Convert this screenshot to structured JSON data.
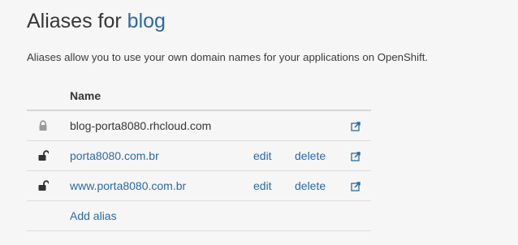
{
  "heading": {
    "prefix": "Aliases for",
    "app_name": "blog"
  },
  "description": "Aliases allow you to use your own domain names for your applications on OpenShift.",
  "table": {
    "column_name": "Name",
    "rows": [
      {
        "name": "blog-porta8080.rhcloud.com",
        "locked": true,
        "edit": "",
        "delete": ""
      },
      {
        "name": "porta8080.com.br",
        "locked": false,
        "edit": "edit",
        "delete": "delete"
      },
      {
        "name": "www.porta8080.com.br",
        "locked": false,
        "edit": "edit",
        "delete": "delete"
      }
    ],
    "add_alias": "Add alias"
  },
  "icons": {
    "locked": "lock-closed-icon",
    "unlocked": "lock-open-icon",
    "external": "external-link-icon"
  },
  "colors": {
    "link": "#2b6aa3",
    "text": "#363636",
    "background": "#f6f6f6"
  }
}
